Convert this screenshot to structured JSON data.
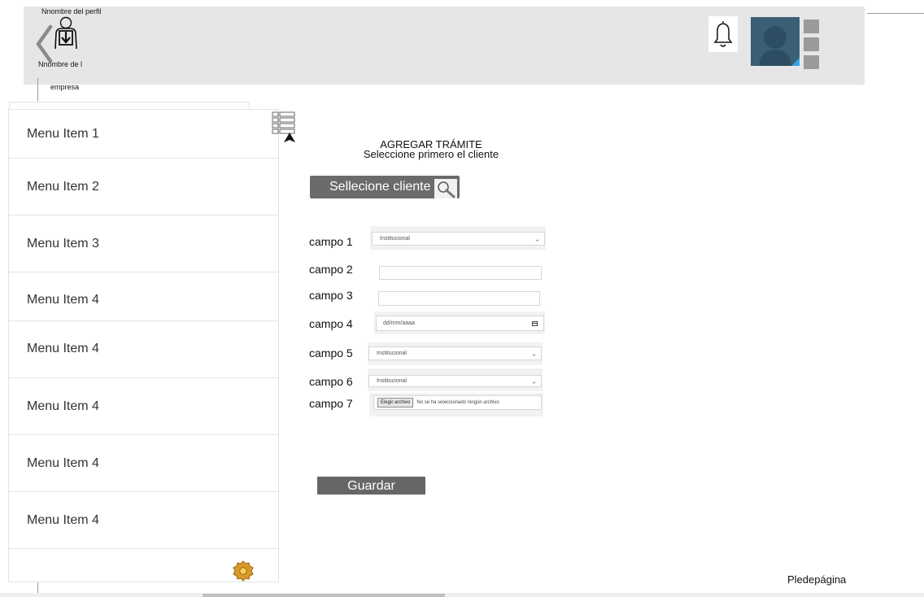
{
  "header": {
    "profile_name": "Nnombre del perfil",
    "company_name_line1": "Nnombre de l",
    "company_name_line2": "empresa",
    "icons": {
      "back": "chevron-left-icon",
      "profile": "user-download-icon",
      "notifications": "bell-icon",
      "avatar": "user-avatar-icon",
      "more": "vertical-squares-menu-icon"
    }
  },
  "sidebar": {
    "items": [
      {
        "label": "Menu Item 1"
      },
      {
        "label": "Menu Item 2"
      },
      {
        "label": "Menu Item 3"
      },
      {
        "label": "Menu Item 4"
      },
      {
        "label": "Menu Item 4"
      },
      {
        "label": "Menu Item 4"
      },
      {
        "label": "Menu Item 4"
      },
      {
        "label": "Menu Item 4"
      }
    ],
    "toggle_icon": "list-toggle-icon",
    "settings_icon": "gear-icon"
  },
  "main": {
    "title": "AGREGAR TRÁMITE",
    "subtitle": "Seleccione primero el cliente",
    "select_client_label": "Sellecione cliente",
    "select_client_icon": "magnifier-icon",
    "fields": [
      {
        "label": "campo 1",
        "value": "Institucional"
      },
      {
        "label": "campo 2",
        "value": ""
      },
      {
        "label": "campo 3",
        "value": ""
      },
      {
        "label": "campo 4",
        "placeholder": "dd/mm/aaaa"
      },
      {
        "label": "campo 5",
        "value": "Institucional"
      },
      {
        "label": "campo 6",
        "value": "Institucional"
      },
      {
        "label": "campo 7",
        "button": "Elegir archivo",
        "status": "No se ha seleccionado ningún archivo"
      }
    ],
    "save_label": "Guardar"
  },
  "footer": {
    "text": "Pledepágina"
  },
  "colors": {
    "header_background": "#e6e6e6",
    "button_background": "#666666",
    "avatar_background": "#3b5f76",
    "avatar_accent": "#2fa4e7",
    "gear": "#d99a2a"
  }
}
